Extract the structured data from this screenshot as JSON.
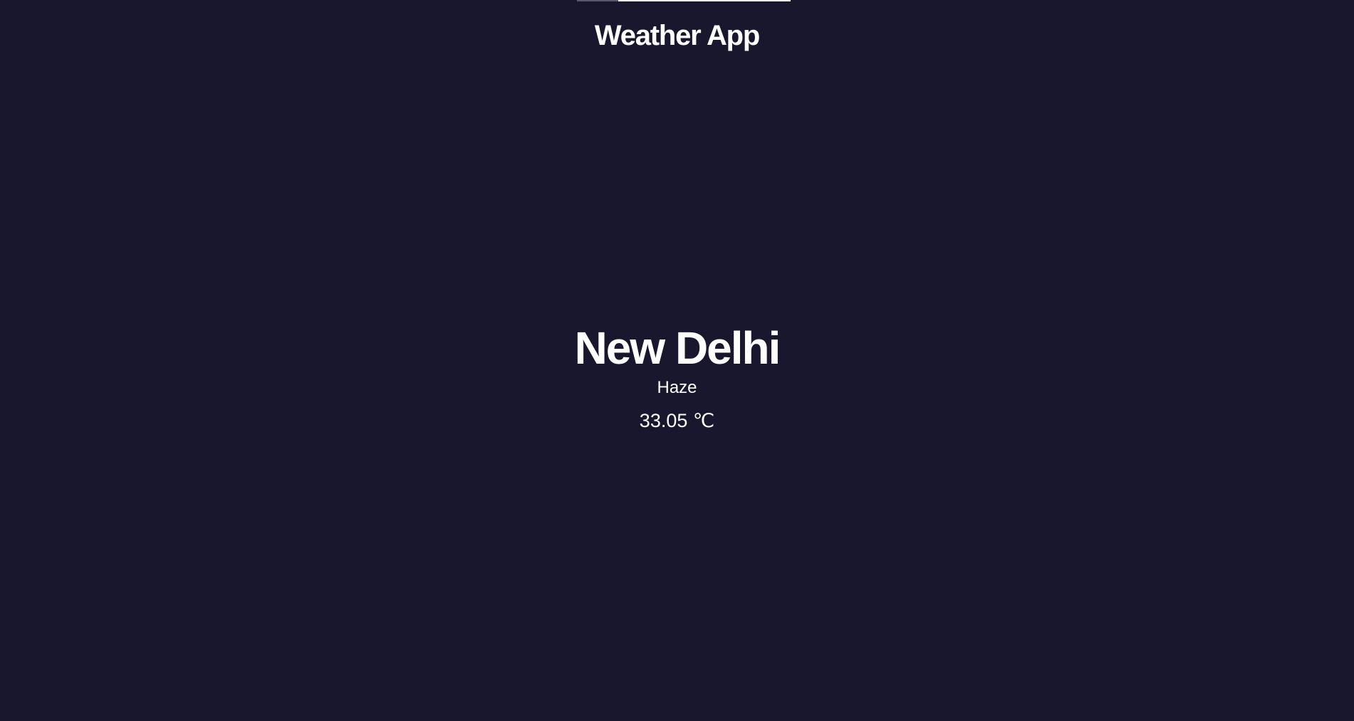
{
  "header": {
    "title": "Weather App"
  },
  "weather": {
    "city": "New Delhi",
    "condition": "Haze",
    "temperature": "33.05 ℃"
  },
  "colors": {
    "background": "#19172d",
    "text": "#ffffff"
  }
}
